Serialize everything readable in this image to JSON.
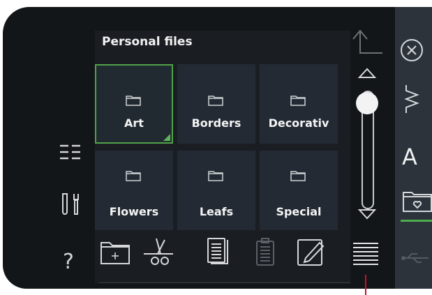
{
  "header": {
    "title": "Personal files"
  },
  "files": [
    {
      "label": "Art",
      "selected": true
    },
    {
      "label": "Borders",
      "selected": false
    },
    {
      "label": "Decorativ",
      "selected": false
    },
    {
      "label": "Flowers",
      "selected": false
    },
    {
      "label": "Leafs",
      "selected": false
    },
    {
      "label": "Special",
      "selected": false
    }
  ],
  "left_sidebar": {
    "help_label": "?"
  },
  "right_strip": {
    "letter_label": "A"
  },
  "icons": {
    "up_arrow": "return-up-icon",
    "close": "close-circle-icon",
    "list": "list-view-icon",
    "settings": "tools-icon",
    "help": "help-icon",
    "stitch": "stitch-icon",
    "font": "font-icon",
    "folder": "folder-heart-icon",
    "usb": "usb-icon",
    "new_folder": "new-folder-icon",
    "cut": "scissors-icon",
    "copy": "copy-icon",
    "paste": "paste-icon",
    "rename": "rename-icon",
    "menu": "menu-lines-icon"
  },
  "colors": {
    "accent": "#4fa24a",
    "background": "#131619",
    "tile": "#232a33",
    "marker": "#c8102e"
  }
}
